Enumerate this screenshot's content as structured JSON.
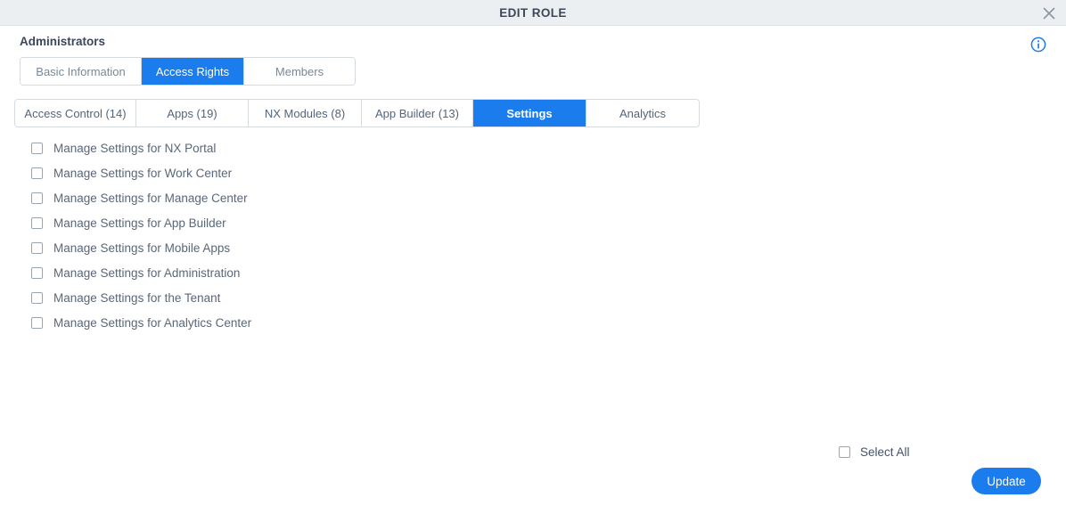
{
  "window": {
    "title": "EDIT ROLE",
    "close_icon": "close-icon",
    "info_icon": "info-icon"
  },
  "role": {
    "name": "Administrators"
  },
  "primary_tabs": [
    {
      "label": "Basic Information",
      "active": false
    },
    {
      "label": "Access Rights",
      "active": true
    },
    {
      "label": "Members",
      "active": false
    }
  ],
  "secondary_tabs": [
    {
      "label": "Access Control (14)",
      "active": false
    },
    {
      "label": "Apps (19)",
      "active": false
    },
    {
      "label": "NX Modules (8)",
      "active": false
    },
    {
      "label": "App Builder (13)",
      "active": false
    },
    {
      "label": "Settings",
      "active": true
    },
    {
      "label": "Analytics",
      "active": false
    }
  ],
  "permissions": [
    {
      "label": "Manage Settings for NX Portal",
      "checked": false
    },
    {
      "label": "Manage Settings for Work Center",
      "checked": false
    },
    {
      "label": "Manage Settings for Manage Center",
      "checked": false
    },
    {
      "label": "Manage Settings for App Builder",
      "checked": false
    },
    {
      "label": "Manage Settings for Mobile Apps",
      "checked": false
    },
    {
      "label": "Manage Settings for Administration",
      "checked": false
    },
    {
      "label": "Manage Settings for the Tenant",
      "checked": false
    },
    {
      "label": "Manage Settings for Analytics Center",
      "checked": false
    }
  ],
  "footer": {
    "select_all_label": "Select All",
    "select_all_checked": false,
    "update_label": "Update"
  },
  "colors": {
    "accent": "#1b7ced",
    "header_bg": "#eceff1",
    "title_text": "#3c4858",
    "body_text": "#5a6778"
  }
}
